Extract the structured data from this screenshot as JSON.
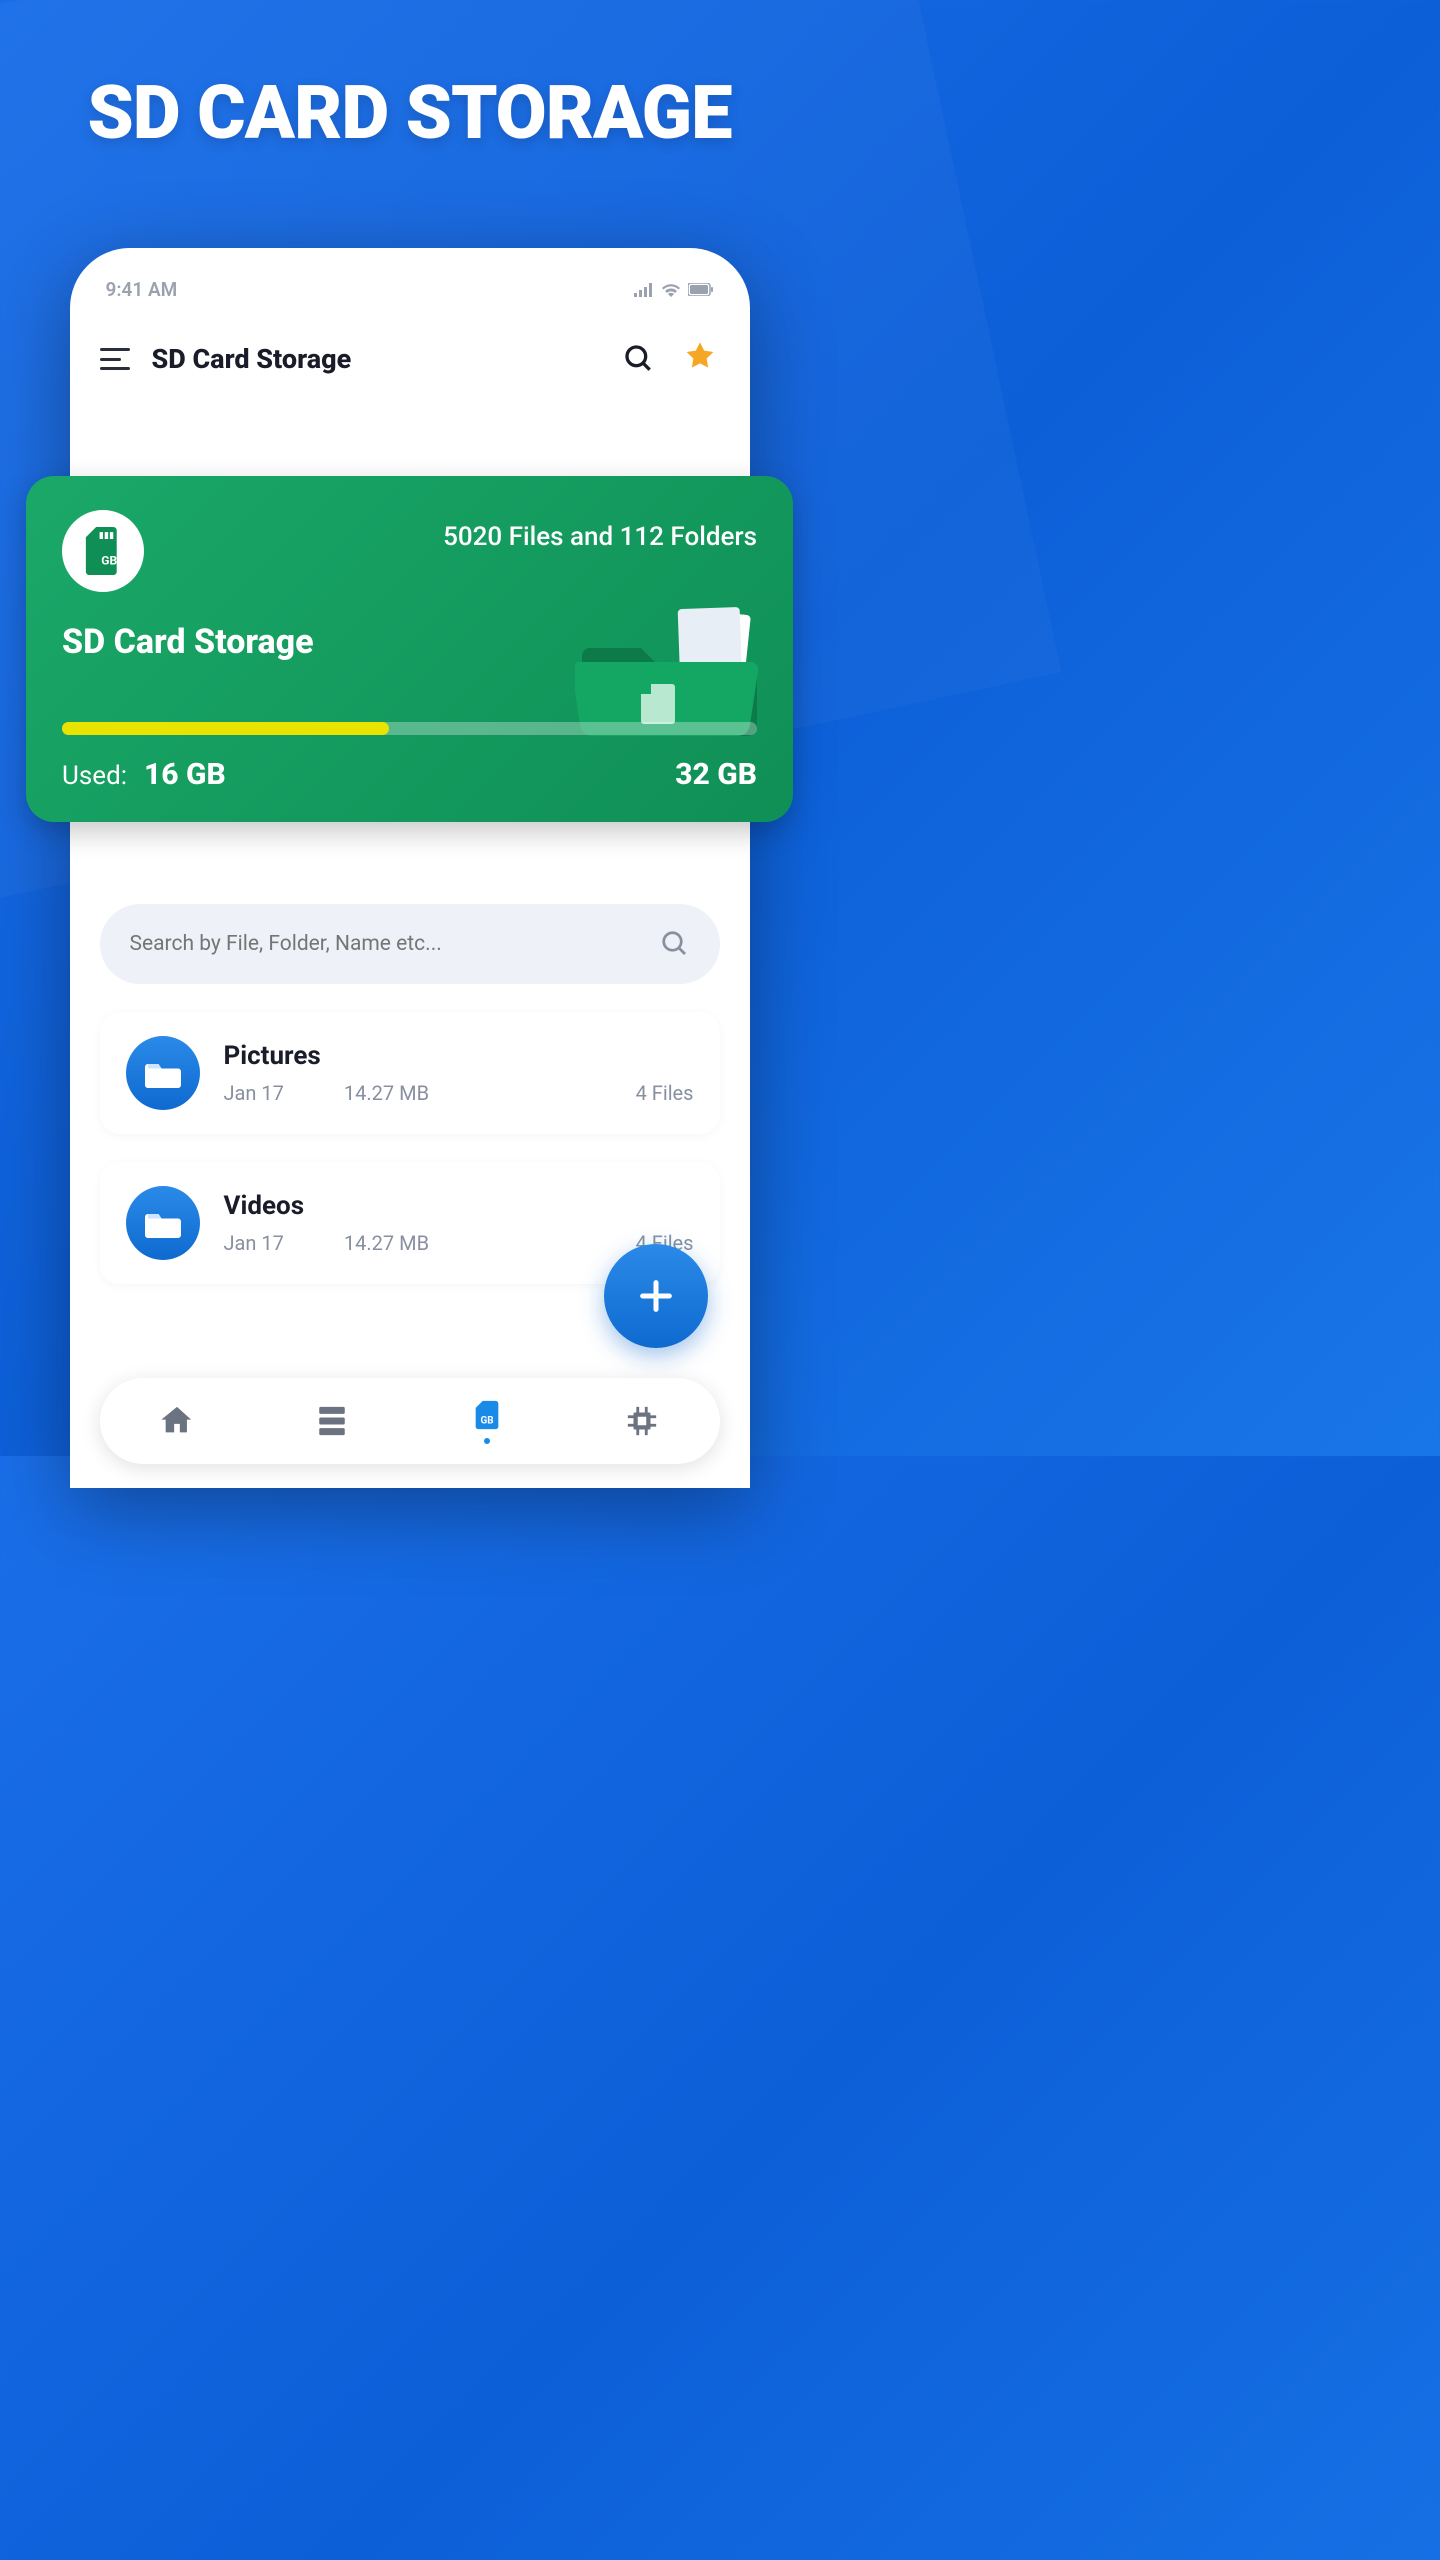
{
  "hero": {
    "title": "SD CARD STORAGE"
  },
  "status_bar": {
    "time": "9:41 AM"
  },
  "header": {
    "title": "SD Card Storage",
    "icons": {
      "menu": "hamburger-icon",
      "search": "search-icon",
      "premium": "crown-icon"
    }
  },
  "storage_card": {
    "icon": "sd-card-icon",
    "stats": "5020 Files and 112 Folders",
    "title": "SD Card Storage",
    "progress_percent": 47,
    "used_label": "Used:",
    "used_value": "16 GB",
    "total_value": "32 GB"
  },
  "search": {
    "placeholder": "Search by File, Folder, Name etc..."
  },
  "folders": [
    {
      "name": "Pictures",
      "date": "Jan 17",
      "size": "14.27 MB",
      "count": "4 Files"
    },
    {
      "name": "Videos",
      "date": "Jan 17",
      "size": "14.27 MB",
      "count": "4 Files"
    }
  ],
  "fab": {
    "label": "+"
  },
  "bottom_nav": {
    "items": [
      {
        "icon": "home-icon",
        "name": "home"
      },
      {
        "icon": "server-icon",
        "name": "storage"
      },
      {
        "icon": "sd-card-icon",
        "name": "sd-card",
        "active": true
      },
      {
        "icon": "chip-icon",
        "name": "hardware"
      }
    ]
  },
  "colors": {
    "accent_green": "#0f8f56",
    "accent_blue": "#0f6ad0",
    "progress": "#e8e400"
  }
}
